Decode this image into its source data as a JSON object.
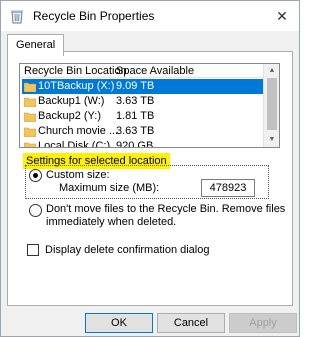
{
  "window": {
    "title": "Recycle Bin Properties",
    "close_glyph": "✕"
  },
  "tabs": [
    {
      "label": "General",
      "selected": true
    }
  ],
  "list": {
    "columns": [
      "Recycle Bin Location",
      "Space Available"
    ],
    "rows": [
      {
        "location": "10TBackup (X:)",
        "space": "9.09 TB",
        "selected": true
      },
      {
        "location": "Backup1 (W:)",
        "space": "3.63 TB",
        "selected": false
      },
      {
        "location": "Backup2 (Y:)",
        "space": "1.81 TB",
        "selected": false
      },
      {
        "location": "Church movie ...",
        "space": "3.63 TB",
        "selected": false
      },
      {
        "location": "Local Disk (C:)",
        "space": "920 GB",
        "selected": false
      }
    ],
    "selection_color": "#0078d7",
    "folder_color": "#f2c55c"
  },
  "settings": {
    "section_label": "Settings for selected location",
    "highlight_color": "#fff200",
    "custom_size_label": "Custom size:",
    "max_size_label": "Maximum size (MB):",
    "max_size_value": "478923",
    "custom_size_selected": true,
    "dont_move_label_line1": "Don't move files to the Recycle Bin. Remove files",
    "dont_move_label_line2": "immediately when deleted.",
    "dont_move_selected": false,
    "confirm_label": "Display delete confirmation dialog",
    "confirm_checked": false
  },
  "buttons": {
    "ok": "OK",
    "cancel": "Cancel",
    "apply": "Apply"
  }
}
